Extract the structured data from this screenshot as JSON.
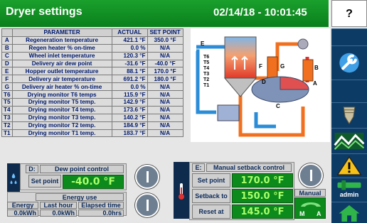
{
  "header": {
    "title": "Dryer settings",
    "datetime": "02/14/18 - 10:01:45",
    "help_label": "?"
  },
  "table": {
    "headers": [
      "PARAMETER",
      "ACTUAL",
      "SET POINT"
    ],
    "rows": [
      {
        "key": "A",
        "name": "Regeneration temperature",
        "actual": "421.1 °F",
        "setpoint": "350.0 °F"
      },
      {
        "key": "B",
        "name": "Regen heater % on-time",
        "actual": "0.0 %",
        "setpoint": "N/A"
      },
      {
        "key": "C",
        "name": "Wheel inlet temperature",
        "actual": "120.3 °F",
        "setpoint": "N/A"
      },
      {
        "key": "D",
        "name": "Delivery air dew point",
        "actual": "-31.6 °F",
        "setpoint": "-40.0 °F"
      },
      {
        "key": "E",
        "name": "Hopper outlet temperature",
        "actual": "88.1 °F",
        "setpoint": "170.0 °F"
      },
      {
        "key": "F",
        "name": "Delivery air temperature",
        "actual": "691.2 °F",
        "setpoint": "180.0 °F"
      },
      {
        "key": "G",
        "name": "Delivery air heater % on-time",
        "actual": "0.0 %",
        "setpoint": "N/A"
      },
      {
        "key": "T6",
        "name": "Drying monitor T6 temps",
        "actual": "115.9 °F",
        "setpoint": "N/A"
      },
      {
        "key": "T5",
        "name": "Drying monitor T5 temp.",
        "actual": "142.9 °F",
        "setpoint": "N/A"
      },
      {
        "key": "T4",
        "name": "Drying monitor T4 temp.",
        "actual": "173.6 °F",
        "setpoint": "N/A"
      },
      {
        "key": "T3",
        "name": "Drying monitor T3 temp.",
        "actual": "140.2 °F",
        "setpoint": "N/A"
      },
      {
        "key": "T2",
        "name": "Drying monitor T2 temp.",
        "actual": "184.9 °F",
        "setpoint": "N/A"
      },
      {
        "key": "T1",
        "name": "Drying monitor T1 temp.",
        "actual": "183.7 °F",
        "setpoint": "N/A"
      }
    ]
  },
  "diagram": {
    "labels": [
      "E",
      "T6",
      "T5",
      "T4",
      "T3",
      "T2",
      "T1",
      "F",
      "G",
      "B",
      "D",
      "A",
      "C"
    ]
  },
  "dew_panel": {
    "tag": "D:",
    "title": "Dew point control",
    "setpoint_label": "Set point",
    "setpoint_value": "-40.0 °F"
  },
  "energy_panel": {
    "title": "Energy use",
    "headers": [
      "Energy",
      "Last hour",
      "Elapsed time"
    ],
    "values": [
      "0.0kWh",
      "0.0kWh",
      "0.0hrs"
    ]
  },
  "setback_panel": {
    "tag": "E:",
    "title": "Manual setback control",
    "setpoint_label": "Set point",
    "setpoint_value": "170.0 °F",
    "setback_label": "Setback to",
    "setback_value": "150.0 °F",
    "reset_label": "Reset at",
    "reset_value": "145.0 °F",
    "mode_label": "Manual",
    "mode_m": "M",
    "mode_a": "A"
  },
  "nav": {
    "admin_label": "admin",
    "icons": [
      "wrench-icon",
      "hopper-icon",
      "trend-icon",
      "warning-icon",
      "admin-icon",
      "home-icon"
    ]
  },
  "colors": {
    "header_green": "#0a7f1c",
    "nav_blue": "#0c3b66",
    "value_green": "#0c8a1c",
    "value_text": "#aaff6a",
    "table_text": "#001a6e"
  }
}
